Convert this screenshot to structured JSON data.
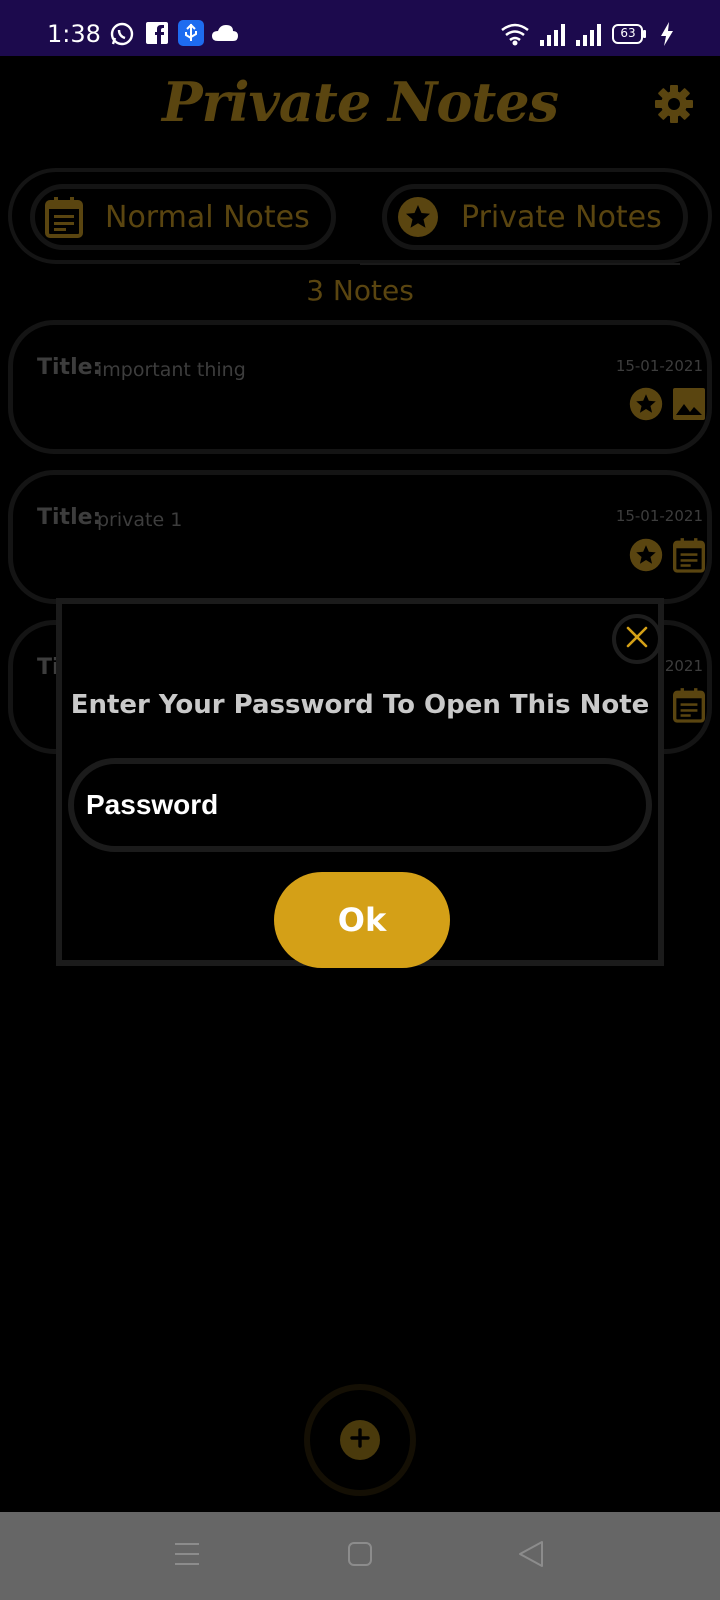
{
  "status_bar": {
    "time": "1:38",
    "battery": "63",
    "left_icons": [
      "whatsapp-icon",
      "facebook-icon",
      "usb-icon",
      "cloud-icon"
    ],
    "right_icons": [
      "wifi-icon",
      "signal-icon",
      "signal-icon",
      "battery-icon",
      "charging-icon"
    ]
  },
  "header": {
    "title": "Private Notes",
    "settings_icon": "gear-icon"
  },
  "tabs": [
    {
      "label": "Normal Notes",
      "icon": "calendar-note-icon"
    },
    {
      "label": "Private Notes",
      "icon": "star-icon"
    }
  ],
  "notes_count": "3 Notes",
  "notes": [
    {
      "title_label": "Title:",
      "title": "important thing",
      "date": "15-01-2021",
      "icons": [
        "star-icon",
        "image-icon"
      ]
    },
    {
      "title_label": "Title:",
      "title": "private 1",
      "date": "15-01-2021",
      "icons": [
        "star-icon",
        "calendar-note-icon"
      ]
    },
    {
      "title_label": "Tit",
      "title": "",
      "date": "2021",
      "icons": [
        "calendar-note-icon"
      ]
    }
  ],
  "dialog": {
    "message": "Enter Your Password To Open This Note",
    "password_placeholder": "Password",
    "ok_label": "Ok",
    "close_icon": "close-icon"
  },
  "fab": {
    "icon": "plus-icon"
  },
  "nav_bar": {
    "icons": [
      "menu-icon",
      "home-icon",
      "back-icon"
    ]
  },
  "colors": {
    "status_bar": "#1c0a4d",
    "accent_dim": "#5a4510",
    "accent": "#d4a017",
    "nav_bar": "#666666"
  }
}
